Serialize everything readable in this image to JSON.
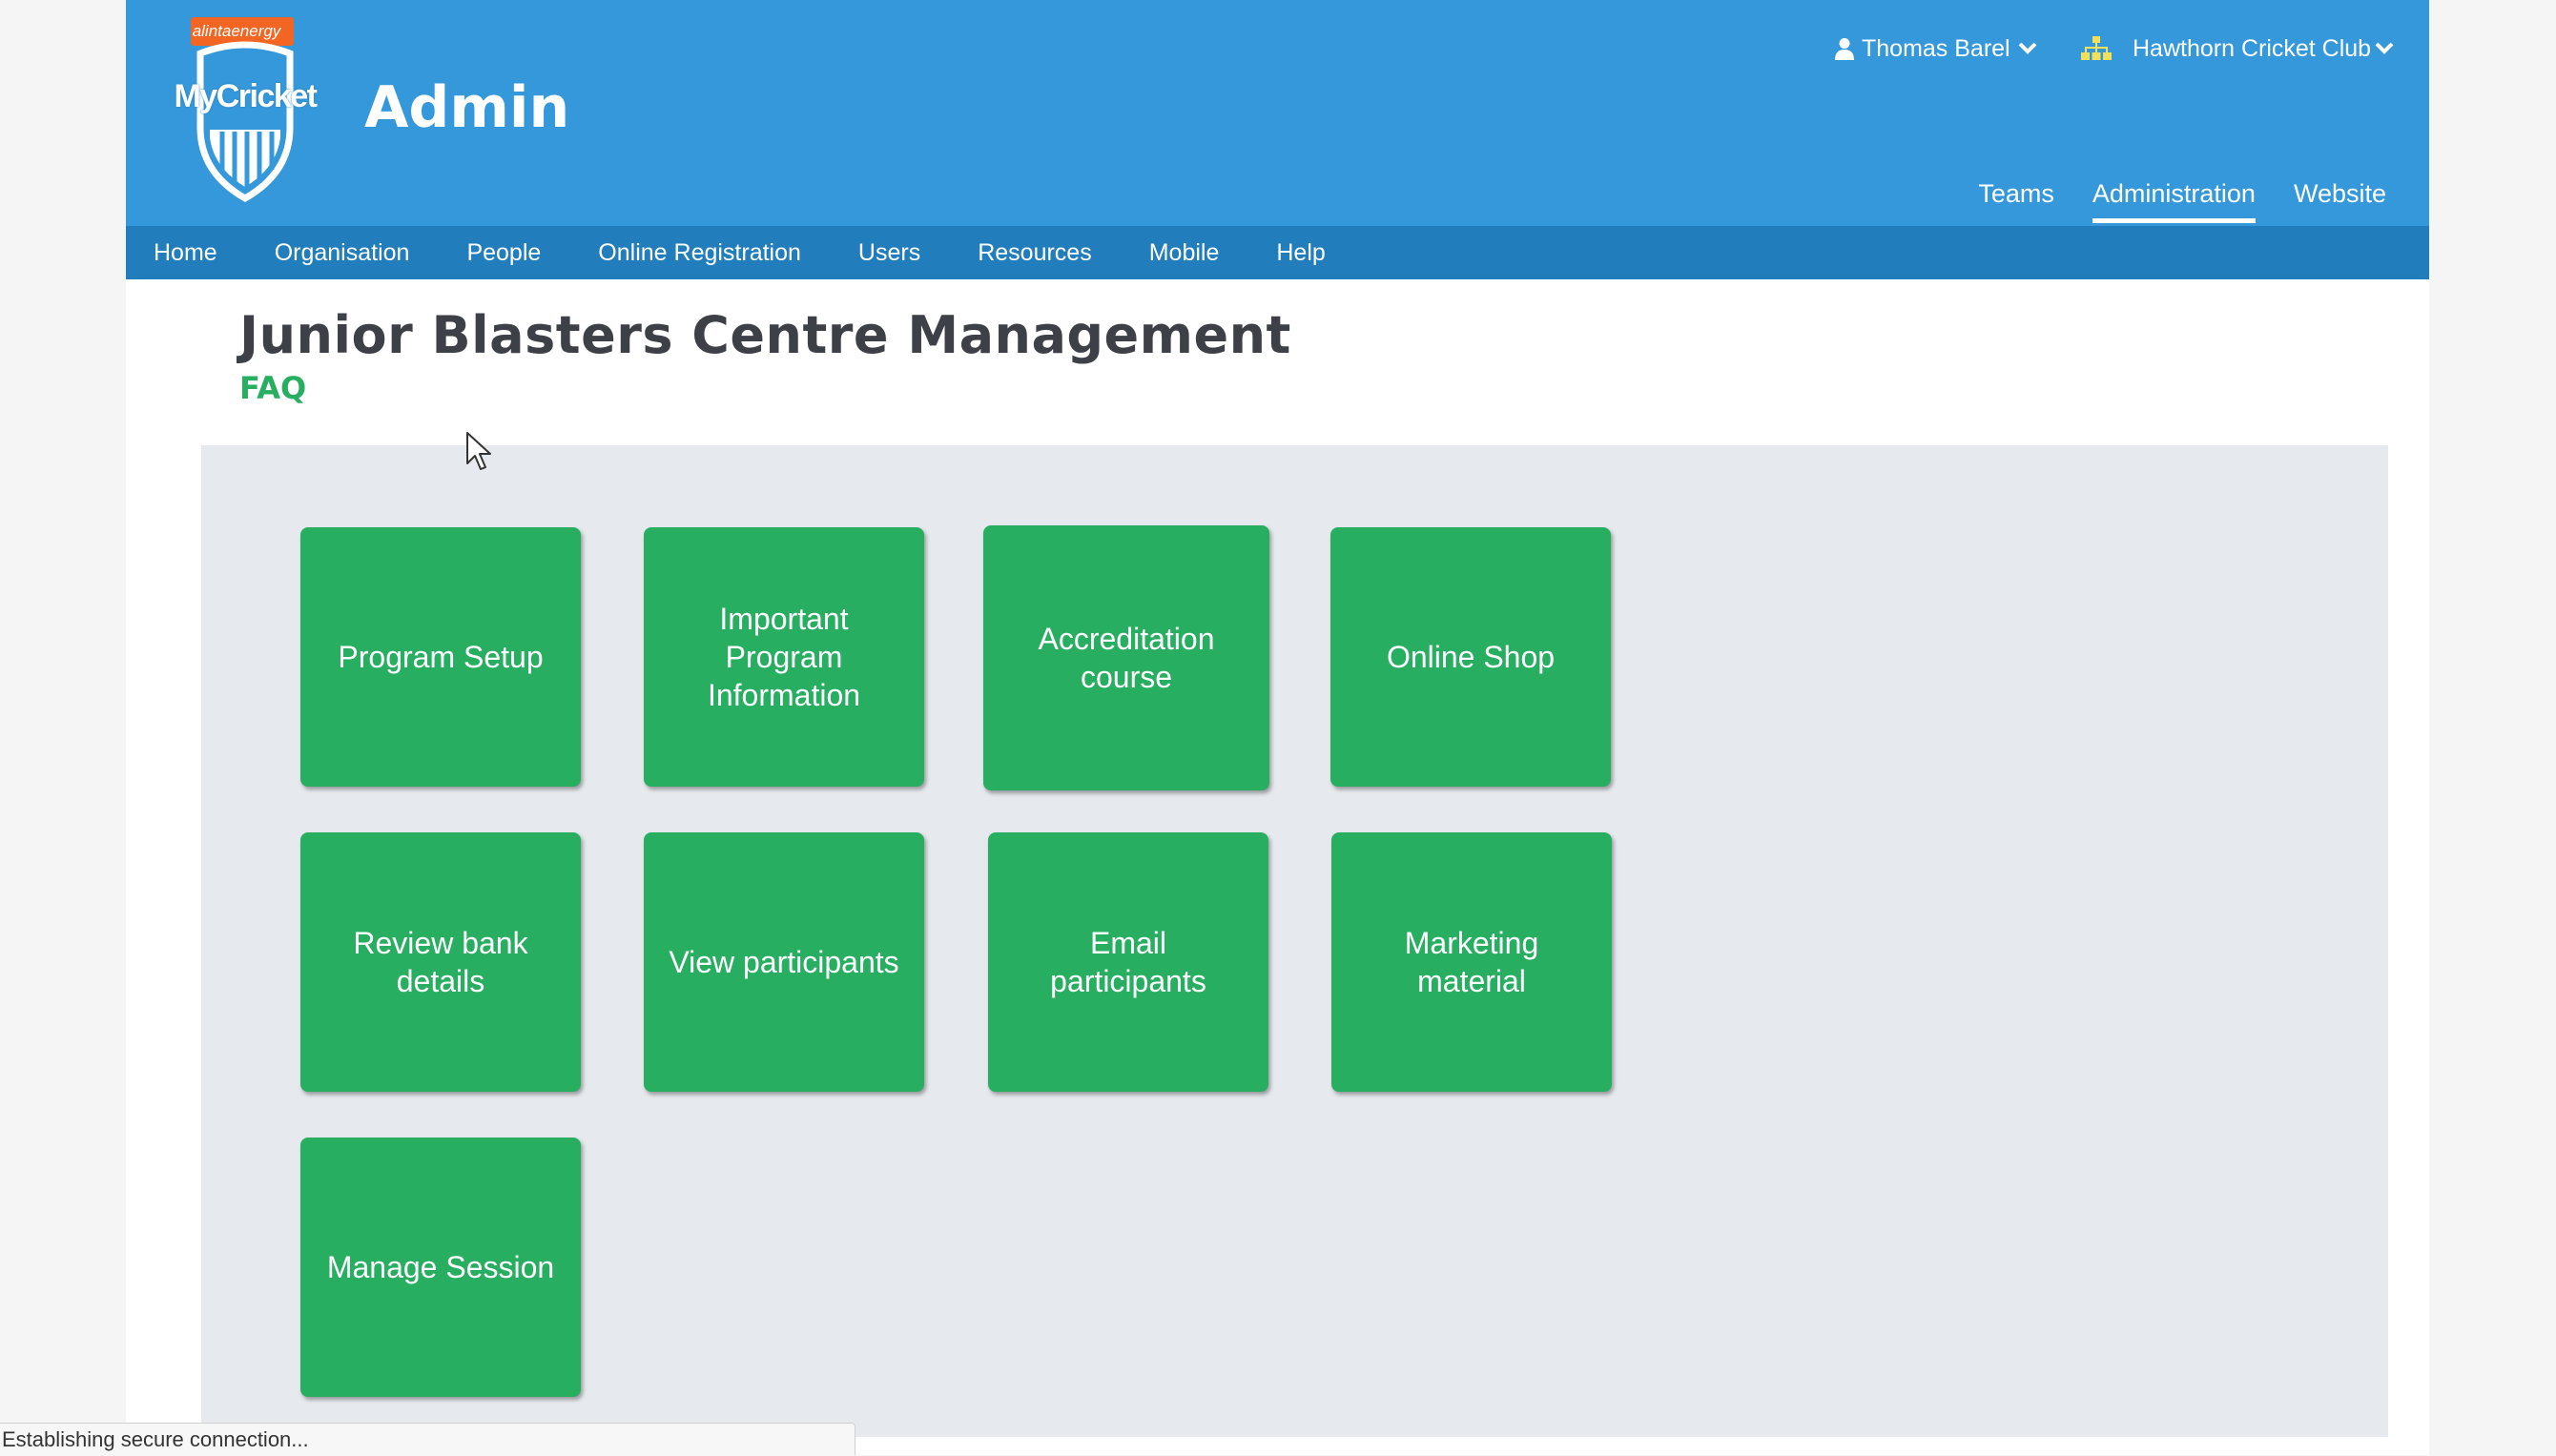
{
  "header": {
    "sponsor": "alintaenergy",
    "logo_text": "MyCricket",
    "app_title": "Admin",
    "user_name": "Thomas Barel",
    "club_name": "Hawthorn Cricket Club",
    "tabs": [
      {
        "label": "Teams",
        "active": false
      },
      {
        "label": "Administration",
        "active": true
      },
      {
        "label": "Website",
        "active": false
      }
    ]
  },
  "nav": {
    "items": [
      "Home",
      "Organisation",
      "People",
      "Online Registration",
      "Users",
      "Resources",
      "Mobile",
      "Help"
    ]
  },
  "main": {
    "title": "Junior Blasters Centre Management",
    "faq": "FAQ",
    "tiles": [
      "Program Setup",
      "Important Program Information",
      "Accreditation course",
      "Online Shop",
      "Review bank details",
      "View participants",
      "Email participants",
      "Marketing material",
      "Manage Session"
    ]
  },
  "status": {
    "text": "Establishing secure connection..."
  },
  "colors": {
    "header_blue": "#3498db",
    "nav_blue": "#217dbb",
    "tile_green": "#27ae60",
    "title_gray": "#3d4047",
    "panel_gray": "#e6e9ed",
    "sponsor_orange": "#f26522"
  },
  "icons": {
    "user": "user-icon",
    "club": "sitemap-icon",
    "dropdown": "chevron-down-icon",
    "logo": "mycricket-shield-logo"
  }
}
